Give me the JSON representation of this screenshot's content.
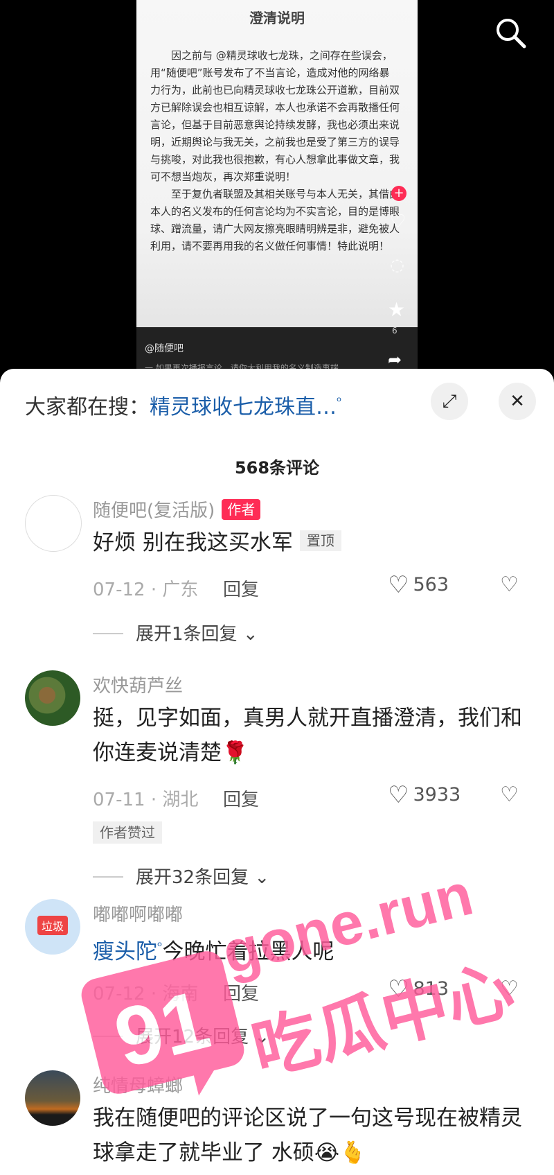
{
  "video": {
    "doc_title": "澄清说明",
    "doc_paragraphs": [
      "因之前与 @精灵球收七龙珠，之间存在些误会，用“随便吧”账号发布了不当言论，造成对他的网络暴力行为，此前也已向精灵球收七龙珠公开道歉，目前双方已解除误会也相互谅解，本人也承诺不会再散播任何言论，但基于目前恶意舆论持续发酵，我也必须出来说明，近期舆论与我无关，之前我也是受了第三方的误导与挑唆，对此我也很抱歉，有心人想拿此事做文章，我可不想当炮灰，再次郑重说明！",
      "至于复仇者联盟及其相关账号与本人无关，其借由本人的名义发布的任何言论均为不实言论，目的是博眼球、蹭流量，请广大网友擦亮眼睛明辨是非，避免被人利用，请不要再用我的名义做任何事情！特此说明！"
    ],
    "author_tag": "@随便吧",
    "subtitle": "一 如果再次播报言论，请你大利用我的名义制造事端",
    "fav_count": "6",
    "plus": "+"
  },
  "panel": {
    "hot_label": "大家都在搜：",
    "hot_keyword": "精灵球收七龙珠直…",
    "comment_count": "568条评论",
    "expand_icon": "⤢",
    "close_icon": "✕"
  },
  "comments": [
    {
      "user": "随便吧(复活版)",
      "badge": "作者",
      "text": "好烦 别在我这买水军",
      "pin": "置顶",
      "meta": "07-12 · 广东",
      "reply": "回复",
      "likes": "563",
      "expand": "展开1条回复"
    },
    {
      "user": "欢快葫芦丝",
      "text": "挺，见字如面，真男人就开直播澄清，我们和你连麦说清楚🌹",
      "meta": "07-11 · 湖北",
      "reply": "回复",
      "likes": "3933",
      "liked_tag": "作者赞过",
      "expand": "展开32条回复"
    },
    {
      "user": "嘟嘟啊嘟嘟",
      "mention": "瘦头陀",
      "text": "今晚忙着拉黑人呢",
      "meta": "07-12 · 海南",
      "reply": "回复",
      "likes": "813",
      "avatar_text": "垃圾",
      "expand": "展开12条回复"
    },
    {
      "user": "纯情母蟑螂",
      "text": "我在随便吧的评论区说了一句这号现在被精灵球拿走了就毕业了 水硕😭🫰"
    }
  ],
  "watermark": {
    "num": "91",
    "site": "gone.run",
    "cn": "吃瓜中心"
  },
  "colors": {
    "accent": "#fe2c55",
    "link": "#1b5ea9",
    "watermark": "#ff5b9a"
  }
}
